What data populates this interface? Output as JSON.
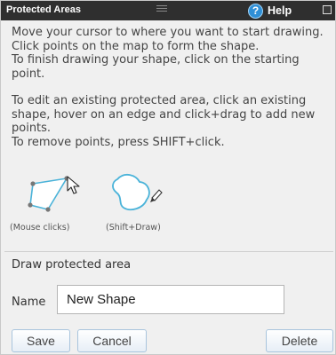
{
  "titlebar": {
    "title": "Protected Areas",
    "help_label": "Help",
    "help_glyph": "?",
    "help_icon": "question-circle-icon",
    "accent": "#2f8fd6"
  },
  "instructions": {
    "draw_lines": [
      "Move your cursor to where you want to start drawing.",
      "Click points on the map to form the shape.",
      "To finish drawing your shape, click on the starting",
      "point."
    ],
    "edit_lines": [
      "To edit an existing protected area, click an existing",
      "shape, hover on an edge and click+drag to add new",
      "points.",
      "To remove points, press SHIFT+click."
    ]
  },
  "illustrations": {
    "mouse_caption": "(Mouse clicks)",
    "shift_caption": "(Shift+Draw)"
  },
  "form": {
    "section_label": "Draw protected area",
    "name_label": "Name",
    "name_value": "New Shape"
  },
  "buttons": {
    "save": "Save",
    "cancel": "Cancel",
    "delete": "Delete"
  }
}
